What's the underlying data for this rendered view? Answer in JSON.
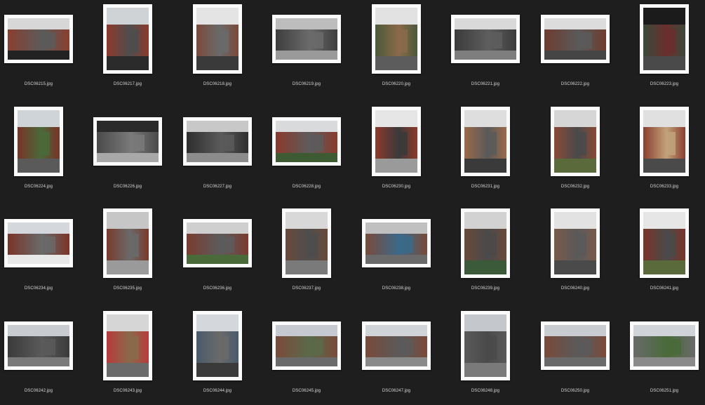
{
  "files": [
    {
      "name": "DSC06215.jpg",
      "orientation": "landscape",
      "palette": [
        "#d7d7d7",
        "#8a3f2f",
        "#5b5b5b",
        "#222222"
      ]
    },
    {
      "name": "DSC06217.jpg",
      "orientation": "portrait",
      "palette": [
        "#cfd3d6",
        "#8e3a2c",
        "#4e4e4e",
        "#2b2b2b"
      ]
    },
    {
      "name": "DSC06218.jpg",
      "orientation": "portrait",
      "palette": [
        "#e4e4e4",
        "#7b4a3a",
        "#6a6a6a",
        "#3a3a3a"
      ]
    },
    {
      "name": "DSC06219.jpg",
      "orientation": "landscape",
      "palette": [
        "#bdbdbd",
        "#3e3e3e",
        "#6b6b6b",
        "#9a9a9a"
      ]
    },
    {
      "name": "DSC06220.jpg",
      "orientation": "portrait",
      "palette": [
        "#e2e2e2",
        "#4a5a3a",
        "#8a6a4a",
        "#5c5c5c"
      ]
    },
    {
      "name": "DSC06221.jpg",
      "orientation": "landscape",
      "palette": [
        "#d9d9d9",
        "#3b3b3b",
        "#5e5e5e",
        "#7e7e7e"
      ]
    },
    {
      "name": "DSC06222.jpg",
      "orientation": "landscape",
      "palette": [
        "#dcdcdc",
        "#6e3c30",
        "#5a5a5a",
        "#454545"
      ]
    },
    {
      "name": "DSC06223.jpg",
      "orientation": "portrait",
      "palette": [
        "#1b1b1b",
        "#3a4a3a",
        "#6a2e2e",
        "#4a4a4a"
      ]
    },
    {
      "name": "DSC06224.jpg",
      "orientation": "portrait",
      "palette": [
        "#cfd4d8",
        "#7a3328",
        "#4a6a3a",
        "#5a5a5a"
      ]
    },
    {
      "name": "DSC06226.jpg",
      "orientation": "landscape",
      "palette": [
        "#2a2a2a",
        "#4a4a4a",
        "#7a7a7a",
        "#a8a8a8"
      ]
    },
    {
      "name": "DSC06227.jpg",
      "orientation": "landscape",
      "palette": [
        "#c8c8c8",
        "#2e2e2e",
        "#5a5a5a",
        "#8c8c8c"
      ]
    },
    {
      "name": "DSC06228.jpg",
      "orientation": "landscape",
      "palette": [
        "#d8dadc",
        "#8b3a2c",
        "#5c5c5c",
        "#3e5a32"
      ]
    },
    {
      "name": "DSC06230.jpg",
      "orientation": "portrait",
      "palette": [
        "#e6e6e6",
        "#8e3a2c",
        "#3a3a3a",
        "#9a9a9a"
      ]
    },
    {
      "name": "DSC06231.jpg",
      "orientation": "portrait",
      "palette": [
        "#dedede",
        "#9a6a4a",
        "#5a5a5a",
        "#3a3a3a"
      ]
    },
    {
      "name": "DSC06232.jpg",
      "orientation": "portrait",
      "palette": [
        "#d6d6d6",
        "#8a4a36",
        "#4a4a4a",
        "#5a6a3a"
      ]
    },
    {
      "name": "DSC06233.jpg",
      "orientation": "portrait",
      "palette": [
        "#e0e0e0",
        "#8a3e30",
        "#c2a27a",
        "#4a4a4a"
      ]
    },
    {
      "name": "DSC06234.jpg",
      "orientation": "landscape",
      "palette": [
        "#d4d8dc",
        "#7a3428",
        "#6a6a6a",
        "#e8e8e8"
      ]
    },
    {
      "name": "DSC06235.jpg",
      "orientation": "portrait",
      "palette": [
        "#c6c6c6",
        "#7a3a2c",
        "#6a6a6a",
        "#9a9a9a"
      ]
    },
    {
      "name": "DSC06236.jpg",
      "orientation": "landscape",
      "palette": [
        "#cfcfcf",
        "#7a3c30",
        "#5c5c5c",
        "#4a6a3a"
      ]
    },
    {
      "name": "DSC06237.jpg",
      "orientation": "portrait",
      "palette": [
        "#d8d8d8",
        "#6a4a3a",
        "#4e4e4e",
        "#7a7a7a"
      ]
    },
    {
      "name": "DSC06238.jpg",
      "orientation": "landscape",
      "palette": [
        "#c0c0c0",
        "#7a4a3a",
        "#3a6a8a",
        "#6a6a6a"
      ]
    },
    {
      "name": "DSC06239.jpg",
      "orientation": "portrait",
      "palette": [
        "#d2d2d2",
        "#6a4a3a",
        "#4a4a4a",
        "#3a5a3a"
      ]
    },
    {
      "name": "DSC06240.jpg",
      "orientation": "portrait",
      "palette": [
        "#e2e2e2",
        "#7a5a4a",
        "#5a5a5a",
        "#4a4a4a"
      ]
    },
    {
      "name": "DSC06241.jpg",
      "orientation": "portrait",
      "palette": [
        "#e6e6e6",
        "#7a3428",
        "#4a4a4a",
        "#5a6a3a"
      ]
    },
    {
      "name": "DSC06242.jpg",
      "orientation": "landscape",
      "palette": [
        "#c8ccd0",
        "#3a3a3a",
        "#5a5a5a",
        "#7a7a7a"
      ]
    },
    {
      "name": "DSC06243.jpg",
      "orientation": "portrait",
      "palette": [
        "#d6d6d6",
        "#b83a3a",
        "#8a6a4a",
        "#6a6a6a"
      ]
    },
    {
      "name": "DSC06244.jpg",
      "orientation": "portrait",
      "palette": [
        "#d4d8dc",
        "#4a5a6a",
        "#6a6a6a",
        "#3a3a3a"
      ]
    },
    {
      "name": "DSC06245.jpg",
      "orientation": "landscape",
      "palette": [
        "#c6cad0",
        "#7a4a3a",
        "#5a6a4a",
        "#6a6a6a"
      ]
    },
    {
      "name": "DSC06247.jpg",
      "orientation": "landscape",
      "palette": [
        "#d0d4d8",
        "#7a4a3a",
        "#5a5a5a",
        "#8a8a8a"
      ]
    },
    {
      "name": "DSC06248.jpg",
      "orientation": "portrait",
      "palette": [
        "#c4c8cc",
        "#5a5a5a",
        "#4a4a4a",
        "#7a7a7a"
      ]
    },
    {
      "name": "DSC06250.jpg",
      "orientation": "landscape",
      "palette": [
        "#c8ccd0",
        "#7a4a3a",
        "#5a5a5a",
        "#6a6a6a"
      ]
    },
    {
      "name": "DSC06251.jpg",
      "orientation": "landscape",
      "palette": [
        "#d0d4d8",
        "#6a6a6a",
        "#4a6a3a",
        "#8a8a8a"
      ]
    }
  ]
}
